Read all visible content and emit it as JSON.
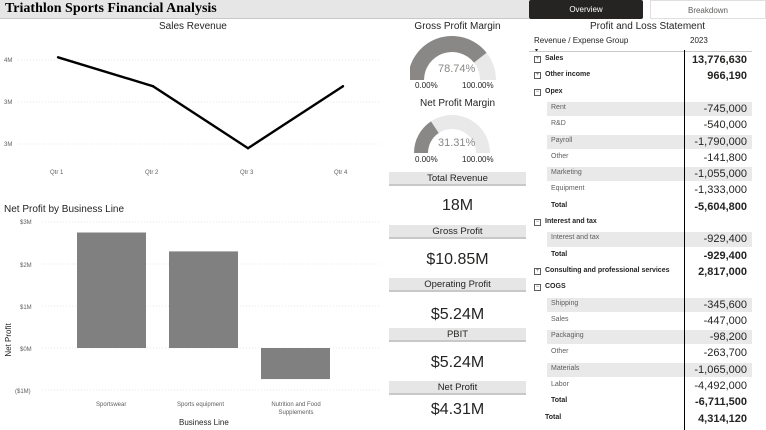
{
  "header": {
    "title": "Triathlon Sports Financial Analysis",
    "tabs": [
      "Overview",
      "Breakdown"
    ],
    "active_tab": "Overview"
  },
  "colors": {
    "header_bg": "#e6e6e6",
    "active_tab": "#252423",
    "bar": "#808080",
    "line": "#000000",
    "gauge_fill": "#8a8886",
    "gauge_track": "#e9e9e9",
    "row_shade": "#e9e9e9"
  },
  "sales_chart": {
    "title": "Sales Revenue",
    "y_ticks": [
      "4M",
      "3M",
      "3M"
    ],
    "x_ticks": [
      "Qtr 1",
      "Qtr 2",
      "Qtr 3",
      "Qtr 4"
    ]
  },
  "profit_chart": {
    "title": "Net Profit by Business Line",
    "y_ticks": [
      "$3M",
      "$2M",
      "$1M",
      "$0M",
      "($1M)"
    ],
    "x_title": "Business Line",
    "y_title": "Net Profit",
    "x_ticks": [
      "Sportswear",
      "Sports equipment",
      "Nutrition and Food Supplements"
    ]
  },
  "chart_data": [
    {
      "type": "line",
      "title": "Sales Revenue",
      "categories": [
        "Qtr 1",
        "Qtr 2",
        "Qtr 3",
        "Qtr 4"
      ],
      "values": [
        4.02,
        3.6,
        2.7,
        3.6
      ],
      "ylim": [
        2.5,
        4.3
      ],
      "grid": true
    },
    {
      "type": "bar",
      "title": "Net Profit by Business Line",
      "categories": [
        "Sportswear",
        "Sports equipment",
        "Nutrition and Food Supplements"
      ],
      "values": [
        2.75,
        2.3,
        -0.74
      ],
      "xlabel": "Business Line",
      "ylabel": "Net Profit",
      "ylim": [
        -1,
        3
      ],
      "grid": true
    }
  ],
  "gauges": [
    {
      "title": "Gross Profit Margin",
      "value_label": "78.74%",
      "min": "0.00%",
      "max": "100.00%",
      "fraction": 0.7874
    },
    {
      "title": "Net Profit Margin",
      "value_label": "31.31%",
      "min": "0.00%",
      "max": "100.00%",
      "fraction": 0.3131
    }
  ],
  "kpis": [
    {
      "label": "Total Revenue",
      "value": "18M"
    },
    {
      "label": "Gross Profit",
      "value": "$10.85M"
    },
    {
      "label": "Operating Profit",
      "value": "$5.24M"
    },
    {
      "label": "PBIT",
      "value": "$5.24M"
    },
    {
      "label": "Net Profit",
      "value": "$4.31M"
    }
  ],
  "pl": {
    "title": "Profit and Loss Statement",
    "col1": "Revenue / Expense Group",
    "col2": "2023",
    "sort_icon": "▾",
    "rows": [
      {
        "label": "Sales",
        "value": "13,776,630",
        "kind": "top",
        "expander": "+"
      },
      {
        "label": "Other income",
        "value": "966,190",
        "kind": "top",
        "expander": "+"
      },
      {
        "label": "Opex",
        "value": "",
        "kind": "top",
        "expander": "−"
      },
      {
        "label": "Rent",
        "value": "-745,000",
        "kind": "child"
      },
      {
        "label": "R&D",
        "value": "-540,000",
        "kind": "child"
      },
      {
        "label": "Payroll",
        "value": "-1,790,000",
        "kind": "child"
      },
      {
        "label": "Other",
        "value": "-141,800",
        "kind": "child"
      },
      {
        "label": "Marketing",
        "value": "-1,055,000",
        "kind": "child"
      },
      {
        "label": "Equipment",
        "value": "-1,333,000",
        "kind": "child"
      },
      {
        "label": "Total",
        "value": "-5,604,800",
        "kind": "tot"
      },
      {
        "label": "Interest and tax",
        "value": "",
        "kind": "top",
        "expander": "−"
      },
      {
        "label": "Interest and tax",
        "value": "-929,400",
        "kind": "child"
      },
      {
        "label": "Total",
        "value": "-929,400",
        "kind": "tot"
      },
      {
        "label": "Consulting and professional services",
        "value": "2,817,000",
        "kind": "top",
        "expander": "+"
      },
      {
        "label": "COGS",
        "value": "",
        "kind": "top",
        "expander": "−"
      },
      {
        "label": "Shipping",
        "value": "-345,600",
        "kind": "child"
      },
      {
        "label": "Sales",
        "value": "-447,000",
        "kind": "child"
      },
      {
        "label": "Packaging",
        "value": "-98,200",
        "kind": "child"
      },
      {
        "label": "Other",
        "value": "-263,700",
        "kind": "child"
      },
      {
        "label": "Materials",
        "value": "-1,065,000",
        "kind": "child"
      },
      {
        "label": "Labor",
        "value": "-4,492,000",
        "kind": "child"
      },
      {
        "label": "Total",
        "value": "-6,711,500",
        "kind": "tot"
      },
      {
        "label": "Total",
        "value": "4,314,120",
        "kind": "grand"
      }
    ]
  }
}
